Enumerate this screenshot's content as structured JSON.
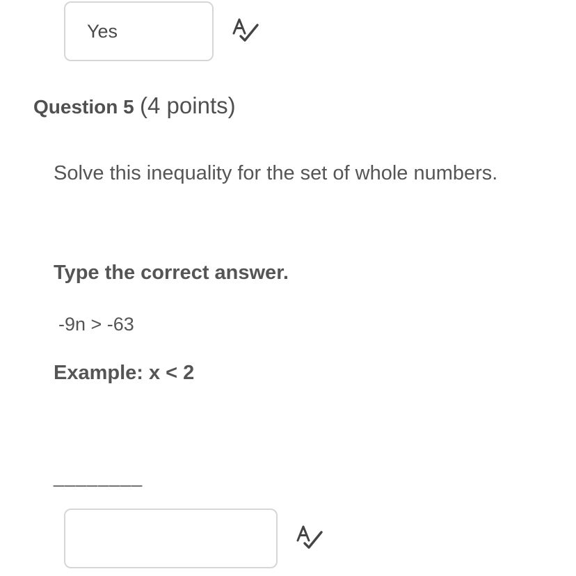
{
  "previous_answer": {
    "value": "Yes",
    "spellcheck_icon": "spellcheck-icon"
  },
  "question": {
    "number_label": "Question 5",
    "points_label": "(4 points)",
    "prompt": "Solve this inequality for the set of whole numbers.",
    "instruction": "Type the correct answer.",
    "inequality": "-9n > -63",
    "example": "Example: x < 2",
    "blank": "________"
  },
  "answer": {
    "value": "",
    "placeholder": "",
    "spellcheck_icon": "spellcheck-icon"
  }
}
